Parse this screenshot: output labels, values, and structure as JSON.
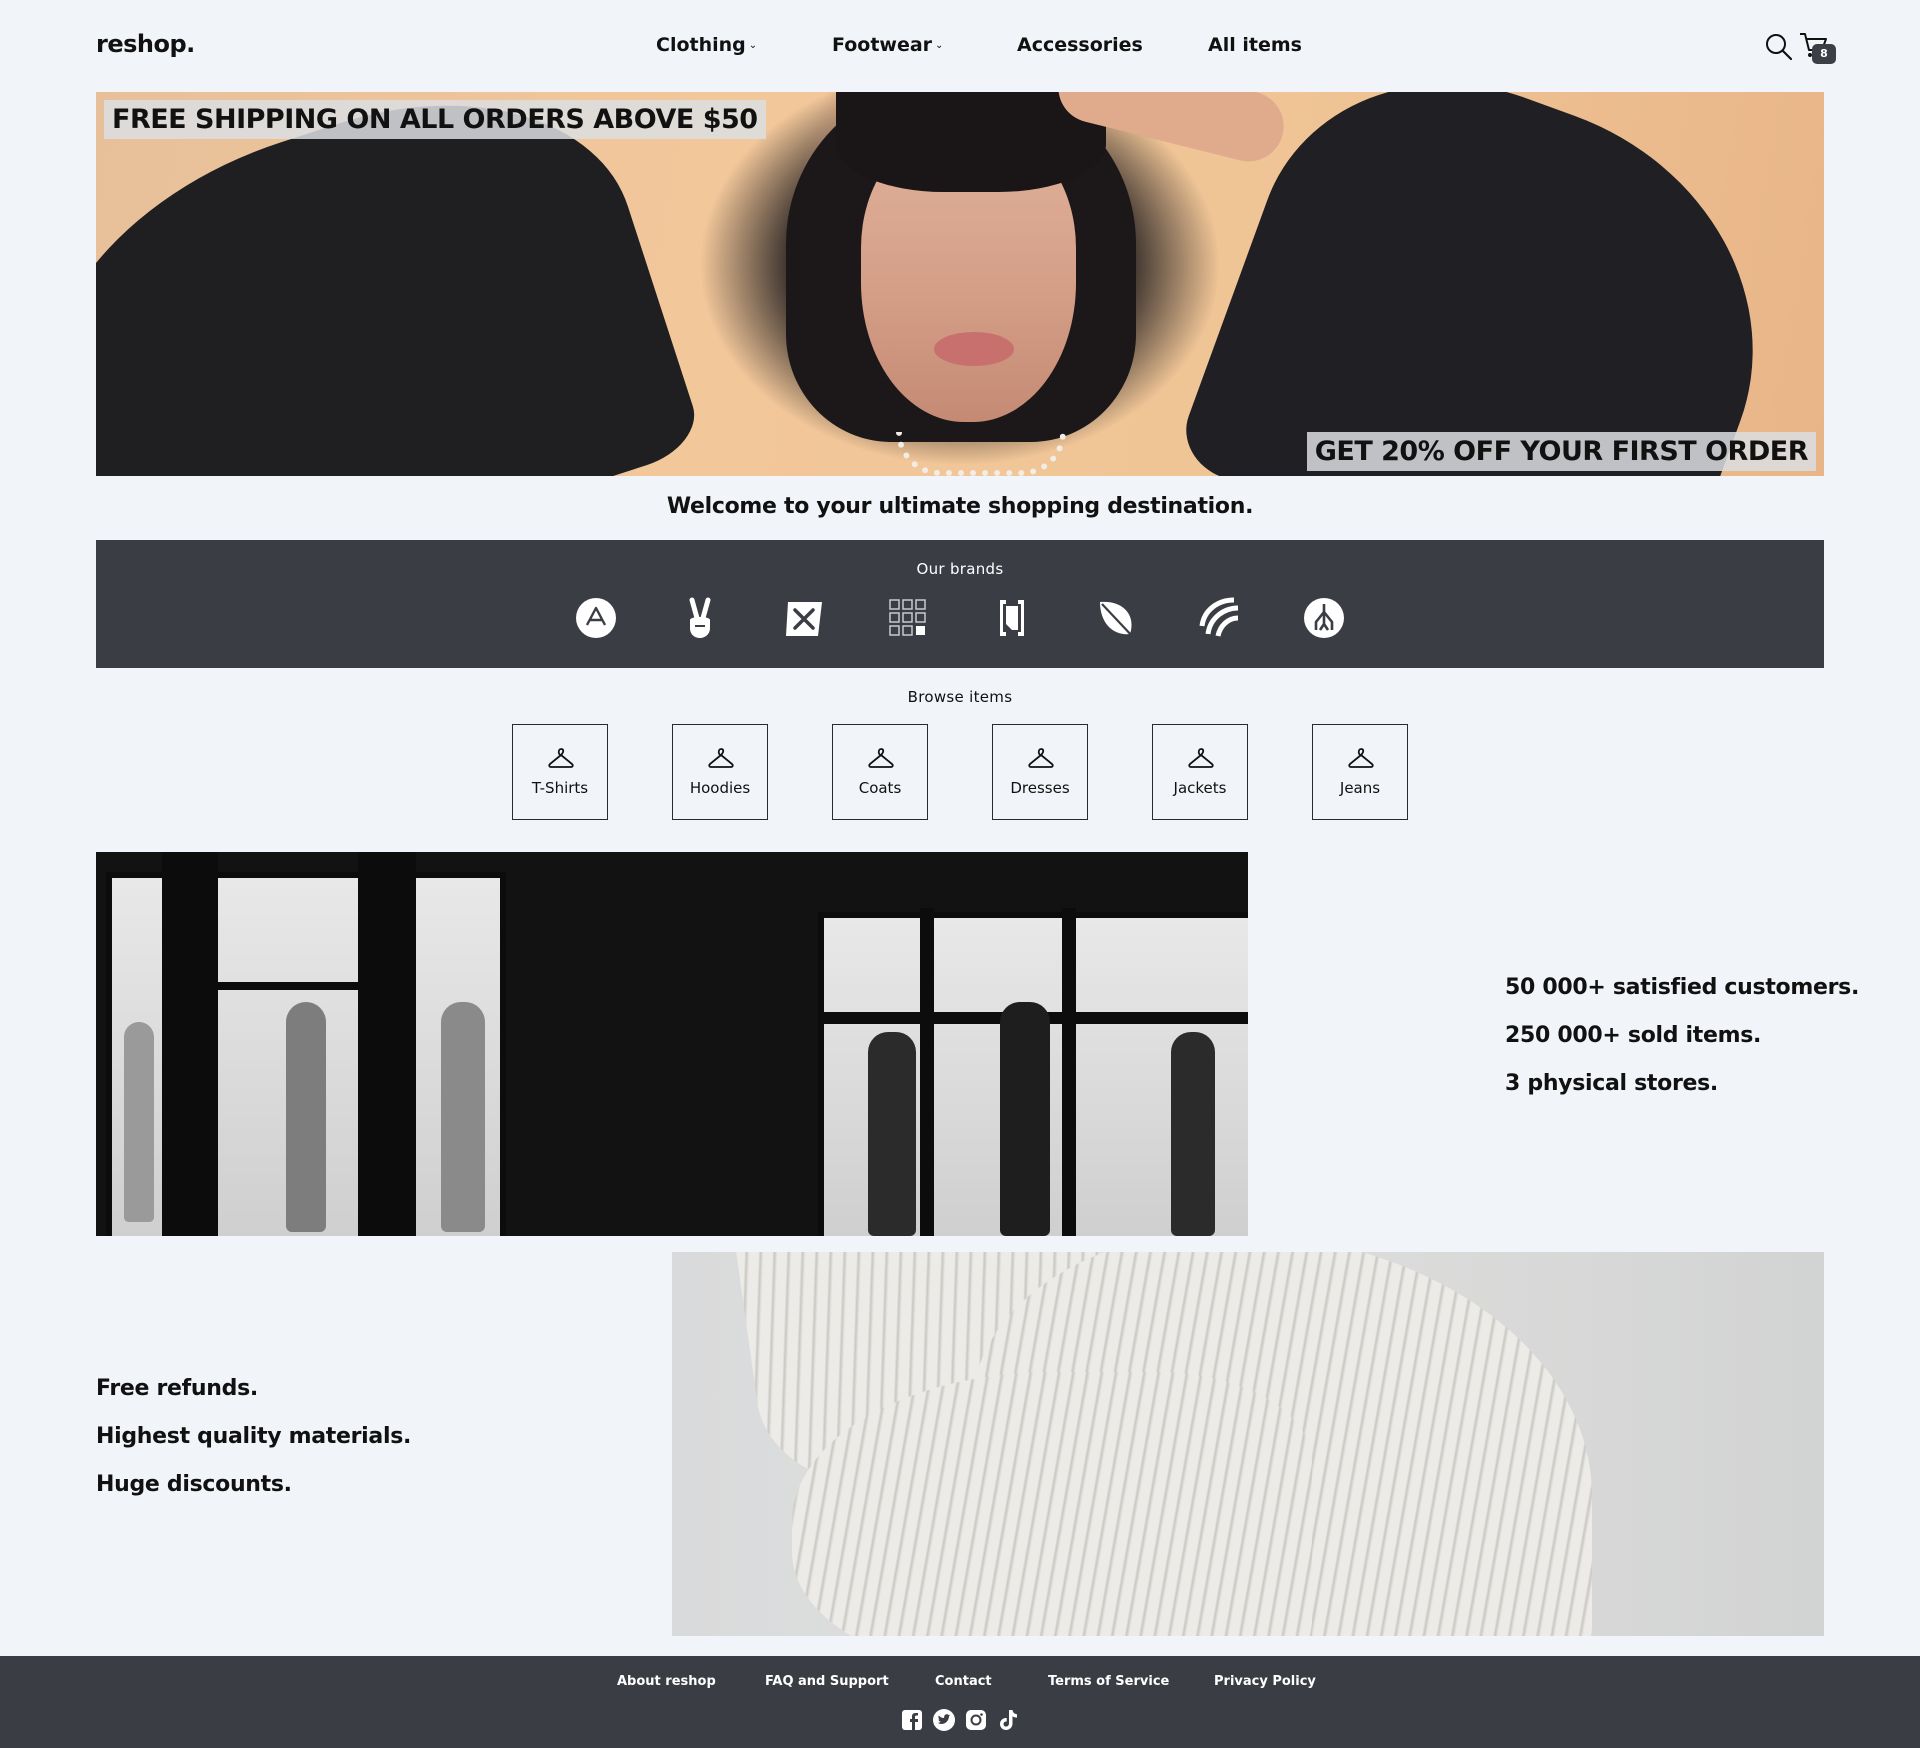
{
  "header": {
    "logo": "reshop.",
    "nav": [
      {
        "label": "Clothing",
        "dropdown": true
      },
      {
        "label": "Footwear",
        "dropdown": true
      },
      {
        "label": "Accessories",
        "dropdown": false
      },
      {
        "label": "All items",
        "dropdown": false
      }
    ],
    "dropdown_glyph": "⌄",
    "cart_count": "8",
    "icons": [
      "search-icon",
      "cart-icon"
    ]
  },
  "hero": {
    "promo_top": "FREE SHIPPING ON ALL ORDERS ABOVE $50",
    "promo_bottom": "GET 20% OFF YOUR FIRST ORDER"
  },
  "welcome": "Welcome to your ultimate shopping destination.",
  "brands": {
    "title": "Our brands",
    "icons": [
      "brand-a-circle-icon",
      "peace-hand-icon",
      "crossed-tools-icon",
      "grid-squares-icon",
      "bracket-logo-icon",
      "leaf-icon",
      "swirl-stripes-icon",
      "tree-circle-icon"
    ]
  },
  "browse": {
    "title": "Browse items",
    "items": [
      "T-Shirts",
      "Hoodies",
      "Coats",
      "Dresses",
      "Jackets",
      "Jeans"
    ],
    "icon": "hanger-icon"
  },
  "stats": [
    "50 000+ satisfied customers.",
    "250 000+ sold items.",
    "3 physical stores."
  ],
  "features": [
    "Free refunds.",
    "Highest quality materials.",
    "Huge discounts."
  ],
  "footer": {
    "links": [
      "About reshop",
      "FAQ and Support",
      "Contact",
      "Terms of Service",
      "Privacy Policy"
    ],
    "social": [
      "facebook-icon",
      "twitter-icon",
      "instagram-icon",
      "tiktok-icon"
    ]
  },
  "colors": {
    "background": "#f1f4f9",
    "dark_panel": "#3b3d44",
    "text": "#111111"
  }
}
